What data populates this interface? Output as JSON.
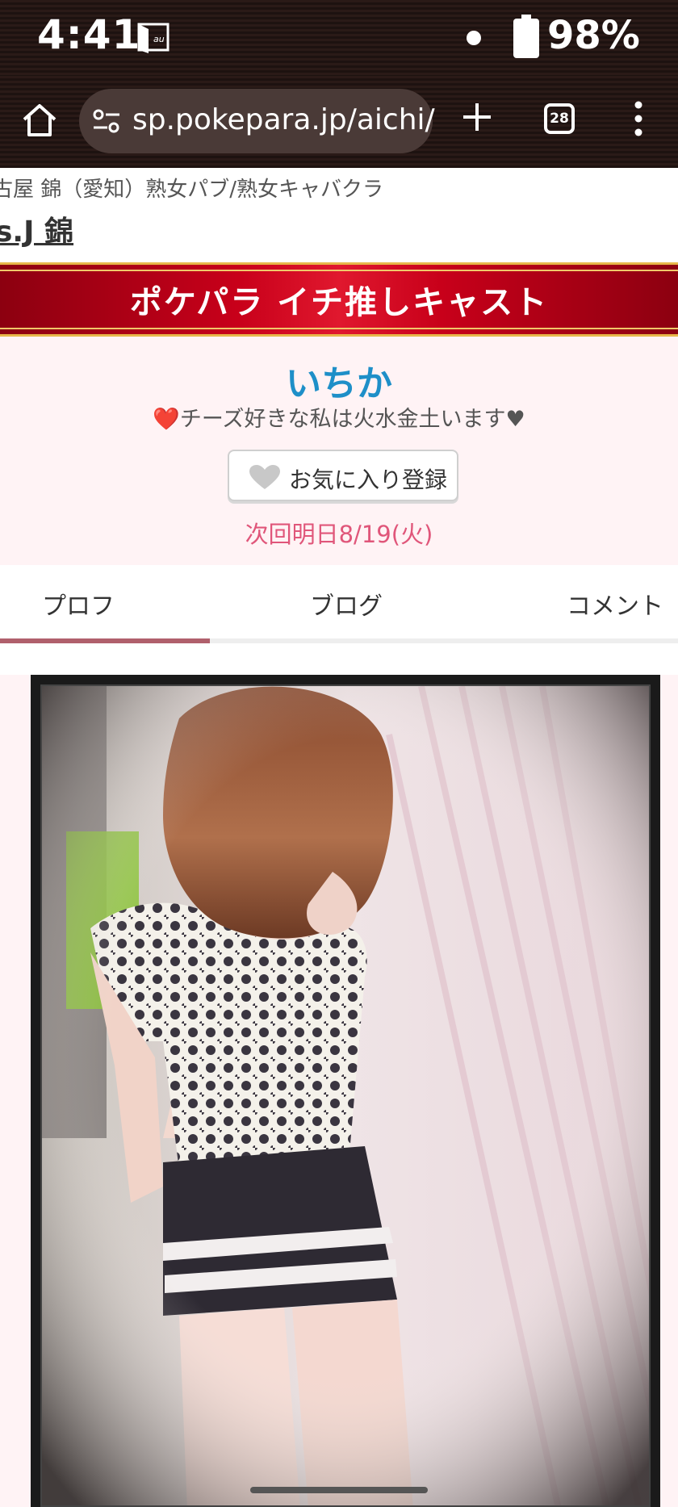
{
  "status_bar": {
    "time": "4:41",
    "battery": "98%"
  },
  "browser": {
    "url": "sp.pokepara.jp/aichi/",
    "tab_count": "28"
  },
  "shop": {
    "category": "古屋 錦（愛知）熟女パブ/熟女キャバクラ",
    "name": "s.J 錦"
  },
  "banner": {
    "title": "ポケパラ イチ推しキャスト"
  },
  "cast": {
    "name": "いちか",
    "catch": "❤️チーズ好きな私は火水金土います♥",
    "favorite_label": "お気に入り登録",
    "next_date": "次回明日8/19(火)"
  },
  "tabs": {
    "items": [
      {
        "label": "プロフ",
        "active": true
      },
      {
        "label": "ブログ",
        "active": false
      },
      {
        "label": "コメント",
        "active": false
      }
    ]
  },
  "colors": {
    "cast_name": "#1e8fc8",
    "next_date": "#e0567a",
    "banner_red": "#c8001a",
    "tab_active": "#b0606c",
    "area_bg": "#fff3f5"
  }
}
